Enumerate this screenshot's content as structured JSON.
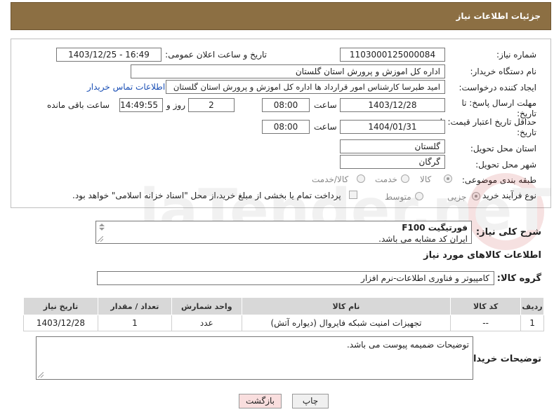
{
  "header": {
    "title": "جزئیات اطلاعات نیاز"
  },
  "fields": {
    "need_number_label": "شماره نیاز:",
    "need_number": "1103000125000084",
    "announce_label": "تاریخ و ساعت اعلان عمومی:",
    "announce_value": "1403/12/25 - 16:49",
    "buyer_org_label": "نام دستگاه خریدار:",
    "buyer_org": "اداره کل اموزش و پرورش استان گلستان",
    "creator_label": "ایجاد کننده درخواست:",
    "creator": "امید طبرسا کارشناس امور قرارداد ها اداره کل اموزش و پرورش استان گلستان",
    "buyer_contact_link": "اطلاعات تماس خریدار",
    "reply_deadline_label": "مهلت ارسال پاسخ: تا",
    "date_label": "تاریخ:",
    "reply_date": "1403/12/28",
    "time_label": "ساعت",
    "reply_time": "08:00",
    "days_value": "2",
    "days_label": "روز و",
    "remaining_time": "14:49:55",
    "remaining_label": "ساعت باقی مانده",
    "validity_label": "حداقل تاریخ اعتبار قیمت: تا",
    "validity_date": "1404/01/31",
    "validity_time": "08:00",
    "province_label": "استان محل تحویل:",
    "province": "گلستان",
    "city_label": "شهر محل تحویل:",
    "city": "گرگان",
    "category_label": "طبقه بندی موضوعی:",
    "category_options": [
      "کالا",
      "خدمت",
      "کالا/خدمت"
    ],
    "process_label": "نوع فرآیند خرید :",
    "process_options": [
      "جزیی",
      "متوسط"
    ],
    "payment_note": "پرداخت تمام یا بخشی از مبلغ خرید،از محل \"اسناد خزانه اسلامی\" خواهد بود."
  },
  "description": {
    "label": "شرح کلی نیاز:",
    "line1": "فورتیگیت F100",
    "line2": "ایران کد مشابه می باشد."
  },
  "goods": {
    "section_title": "اطلاعات کالاهای مورد نیاز",
    "group_label": "گروه کالا:",
    "group_value": "کامپیوتر و فناوری اطلاعات-نرم افزار",
    "columns": [
      "ردیف",
      "کد کالا",
      "نام کالا",
      "واحد شمارش",
      "تعداد / مقدار",
      "تاریخ نیاز"
    ],
    "rows": [
      {
        "row": "1",
        "code": "--",
        "name": "تجهیزات امنیت شبکه فایروال (دیواره آتش)",
        "unit": "عدد",
        "qty": "1",
        "date": "1403/12/28"
      }
    ]
  },
  "buyer_notes": {
    "label": "توضیحات خریدار:",
    "text": "توضیحات ضمیمه پیوست می باشد."
  },
  "buttons": {
    "print": "چاپ",
    "back": "بازگشت"
  },
  "colors": {
    "header_bg": "#8c6f43",
    "link": "#1a4fb5",
    "back_button_bg": "#f9dede"
  }
}
